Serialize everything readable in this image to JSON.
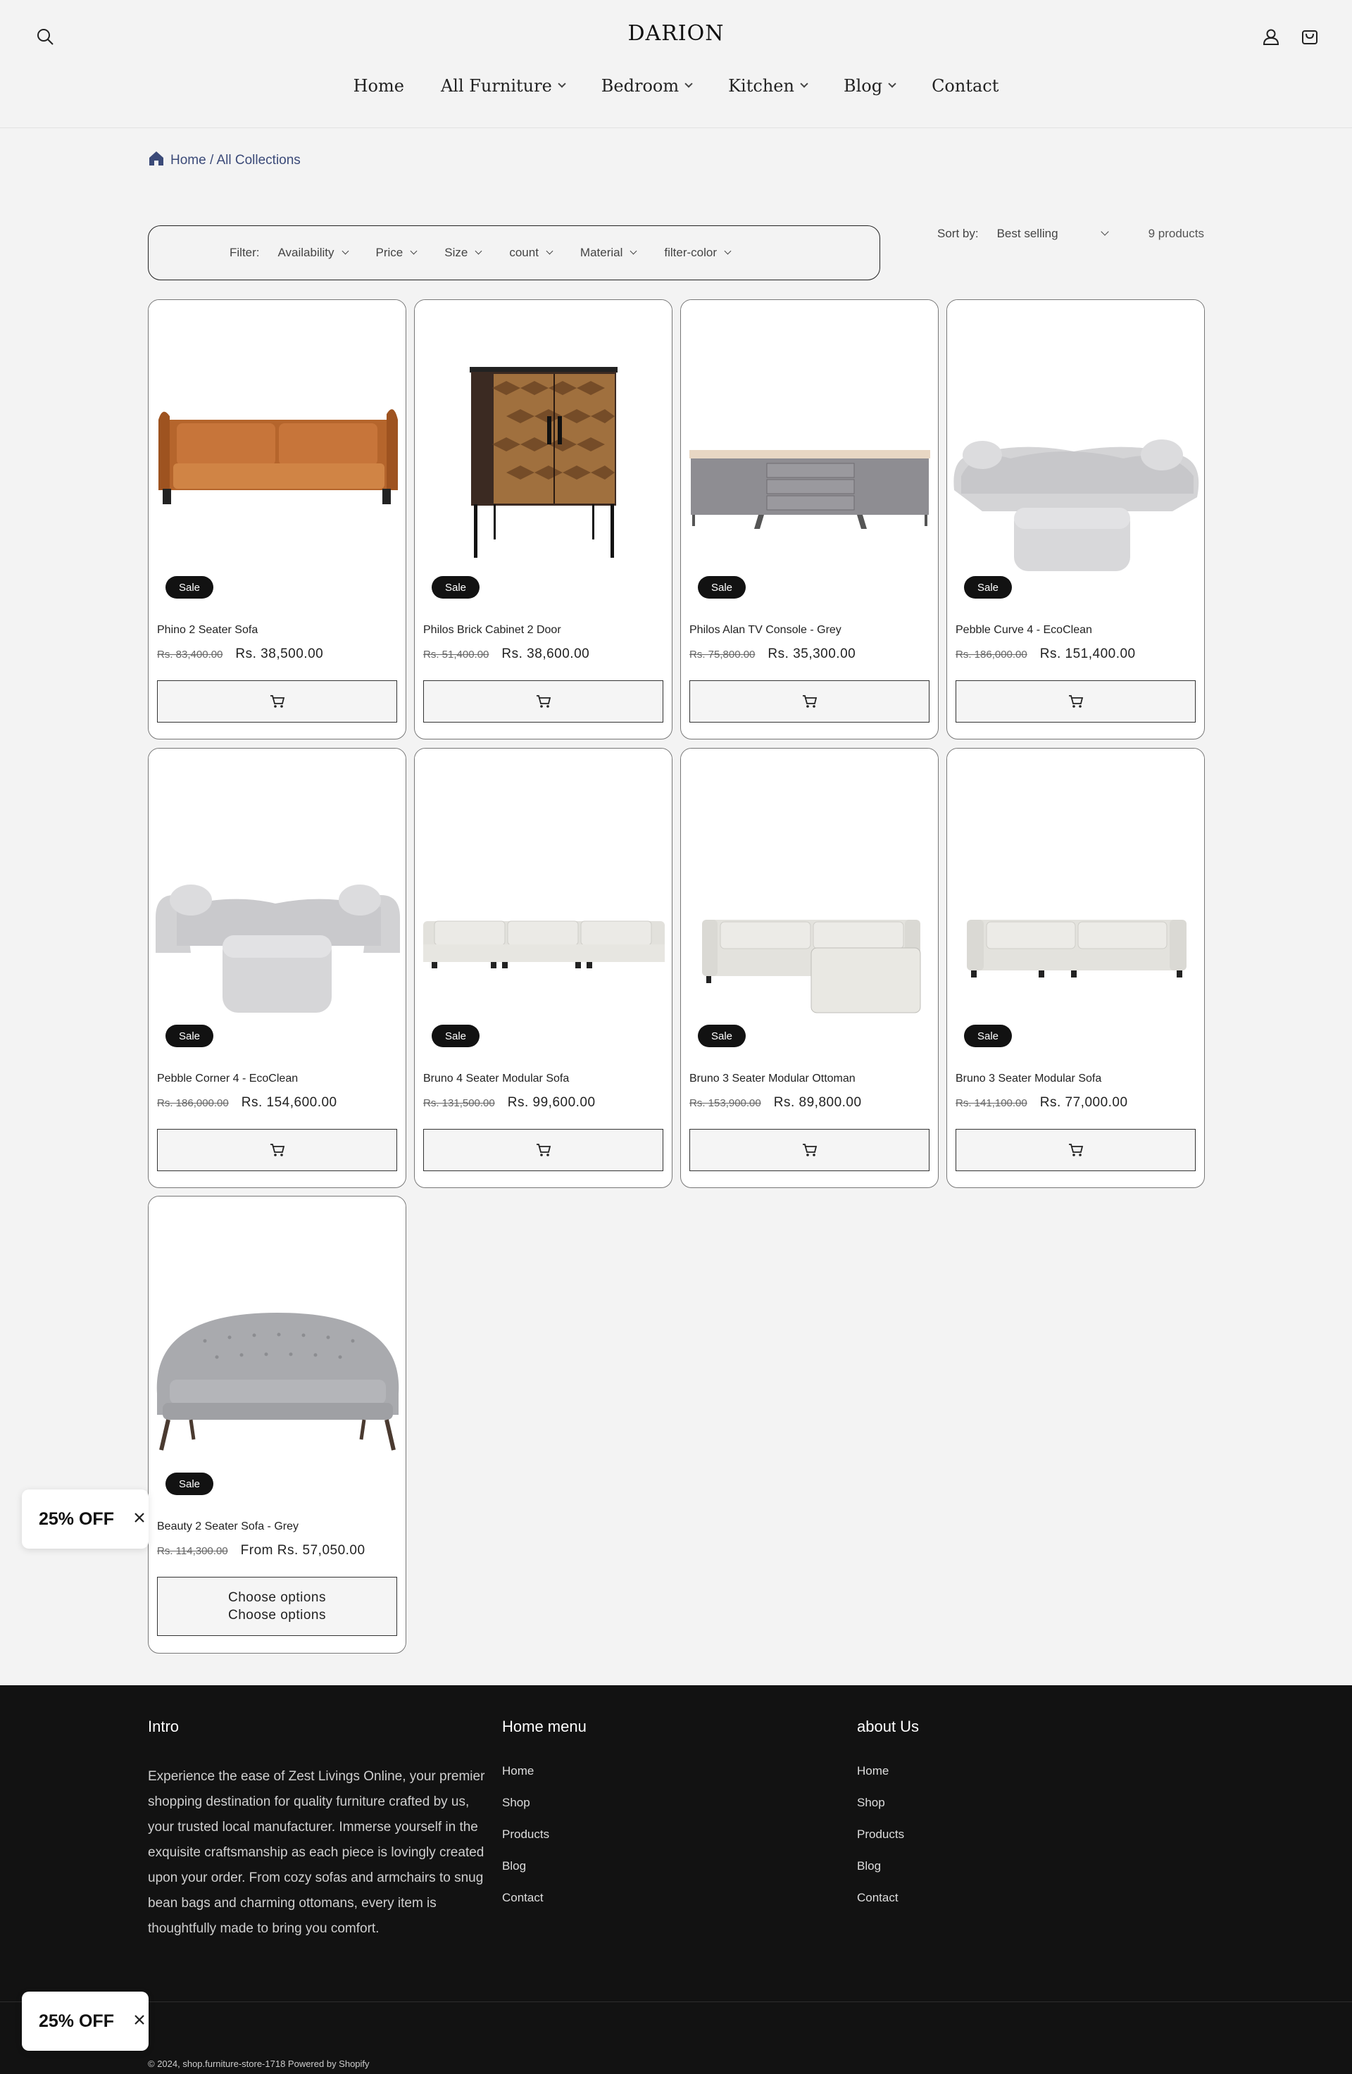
{
  "header": {
    "logo": "DARION",
    "nav": [
      {
        "label": "Home",
        "has_dropdown": false
      },
      {
        "label": "All Furniture",
        "has_dropdown": true
      },
      {
        "label": "Bedroom",
        "has_dropdown": true
      },
      {
        "label": "Kitchen",
        "has_dropdown": true
      },
      {
        "label": "Blog",
        "has_dropdown": true
      },
      {
        "label": "Contact",
        "has_dropdown": false
      }
    ],
    "icons": [
      "search-icon",
      "account-icon",
      "cart-icon"
    ]
  },
  "breadcrumb": {
    "text": "Home / All Collections",
    "icon": "home-icon"
  },
  "filter": {
    "label": "Filter:",
    "items": [
      "Availability",
      "Price",
      "Size",
      "count",
      "Material",
      "filter-color"
    ]
  },
  "sort": {
    "label": "Sort by:",
    "value": "Best selling"
  },
  "product_count": "9 products",
  "products": [
    {
      "name": "Phino 2 Seater Sofa",
      "old_price": "Rs. 83,400.00",
      "price": "Rs. 38,500.00",
      "badge": "Sale",
      "image": "brown-leather-sofa"
    },
    {
      "name": "Philos Brick Cabinet 2 Door",
      "old_price": "Rs. 51,400.00",
      "price": "Rs. 38,600.00",
      "badge": "Sale",
      "image": "wooden-cabinet"
    },
    {
      "name": "Philos Alan TV Console - Grey",
      "old_price": "Rs. 75,800.00",
      "price": "Rs. 35,300.00",
      "badge": "Sale",
      "image": "grey-tv-console"
    },
    {
      "name": "Pebble Curve 4 - EcoClean",
      "old_price": "Rs. 186,000.00",
      "price": "Rs. 151,400.00",
      "badge": "Sale",
      "image": "curved-sofa-ottoman"
    },
    {
      "name": "Pebble Corner 4 - EcoClean",
      "old_price": "Rs. 186,000.00",
      "price": "Rs. 154,600.00",
      "badge": "Sale",
      "image": "corner-sofa-ottoman"
    },
    {
      "name": "Bruno 4 Seater Modular Sofa",
      "old_price": "Rs. 131,500.00",
      "price": "Rs. 99,600.00",
      "badge": "Sale",
      "image": "modular-4-seater-sofa"
    },
    {
      "name": "Bruno 3 Seater Modular Ottoman",
      "old_price": "Rs. 153,900.00",
      "price": "Rs. 89,800.00",
      "badge": "Sale",
      "image": "modular-sofa-ottoman"
    },
    {
      "name": "Bruno 3 Seater Modular Sofa",
      "old_price": "Rs. 141,100.00",
      "price": "Rs. 77,000.00",
      "badge": "Sale",
      "image": "modular-3-seater-sofa"
    },
    {
      "name": "Beauty 2 Seater Sofa - Grey",
      "old_price": "Rs. 114,300.00",
      "price": "From Rs. 57,050.00",
      "badge": "Sale",
      "image": "grey-tufted-sofa",
      "button_lines": [
        "Choose options",
        "Choose options"
      ]
    }
  ],
  "footer": {
    "intro": {
      "heading": "Intro",
      "text": "Experience the ease of Zest Livings Online, your premier shopping destination for quality furniture crafted by us, your trusted local manufacturer. Immerse yourself in the exquisite craftsmanship as each piece is lovingly created upon your order. From cozy sofas and armchairs to snug bean bags and charming ottomans, every item is thoughtfully made to bring you comfort."
    },
    "home_menu": {
      "heading": "Home menu",
      "links": [
        "Home",
        "Shop",
        "Products",
        "Blog",
        "Contact"
      ]
    },
    "about": {
      "heading": "about Us",
      "links": [
        "Home",
        "Shop",
        "Products",
        "Blog",
        "Contact"
      ]
    },
    "copyright": "© 2024, shop.furniture-store-1718 Powered by Shopify"
  },
  "popups": [
    {
      "label": "25% OFF"
    },
    {
      "label": "25% OFF"
    }
  ]
}
